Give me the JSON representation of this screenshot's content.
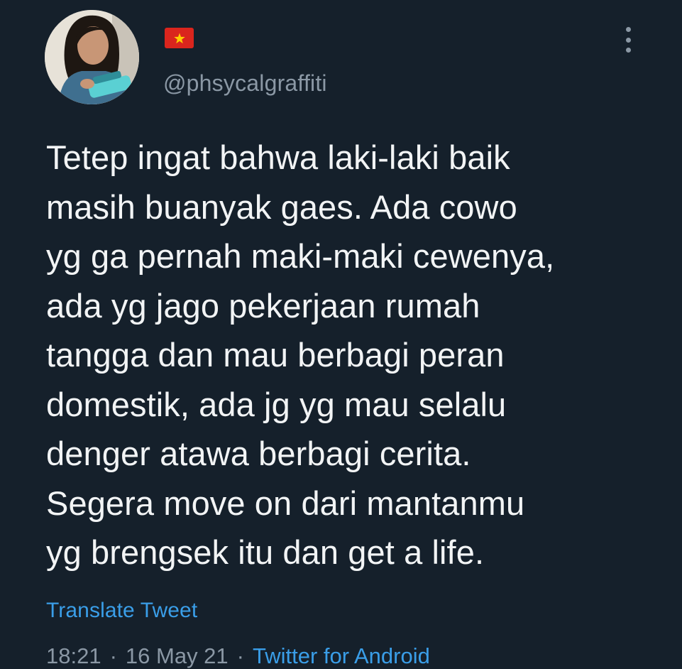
{
  "tweet": {
    "avatar_alt": "profile photo",
    "flag_icon": "vietnam-flag-icon",
    "handle": "@phsycalgraffiti",
    "menu_icon": "more-vertical-icon",
    "body_lines": [
      "Tetep ingat bahwa laki-laki baik",
      "masih buanyak gaes. Ada cowo",
      "yg ga pernah maki-maki cewenya,",
      "ada yg jago pekerjaan rumah",
      "tangga dan mau berbagi peran",
      "domestik, ada jg yg mau selalu",
      "denger atawa berbagi cerita.",
      "Segera move on dari mantanmu",
      "yg brengsek itu dan get a life."
    ],
    "translate_label": "Translate Tweet",
    "time": "18:21",
    "separator": "·",
    "date": "16 May 21",
    "source": "Twitter for Android"
  },
  "colors": {
    "background": "#15202b",
    "text": "#f2f4f5",
    "muted": "#8b98a5",
    "link": "#3a9ee8",
    "flag_red": "#da251d",
    "flag_star": "#ffcd00"
  }
}
